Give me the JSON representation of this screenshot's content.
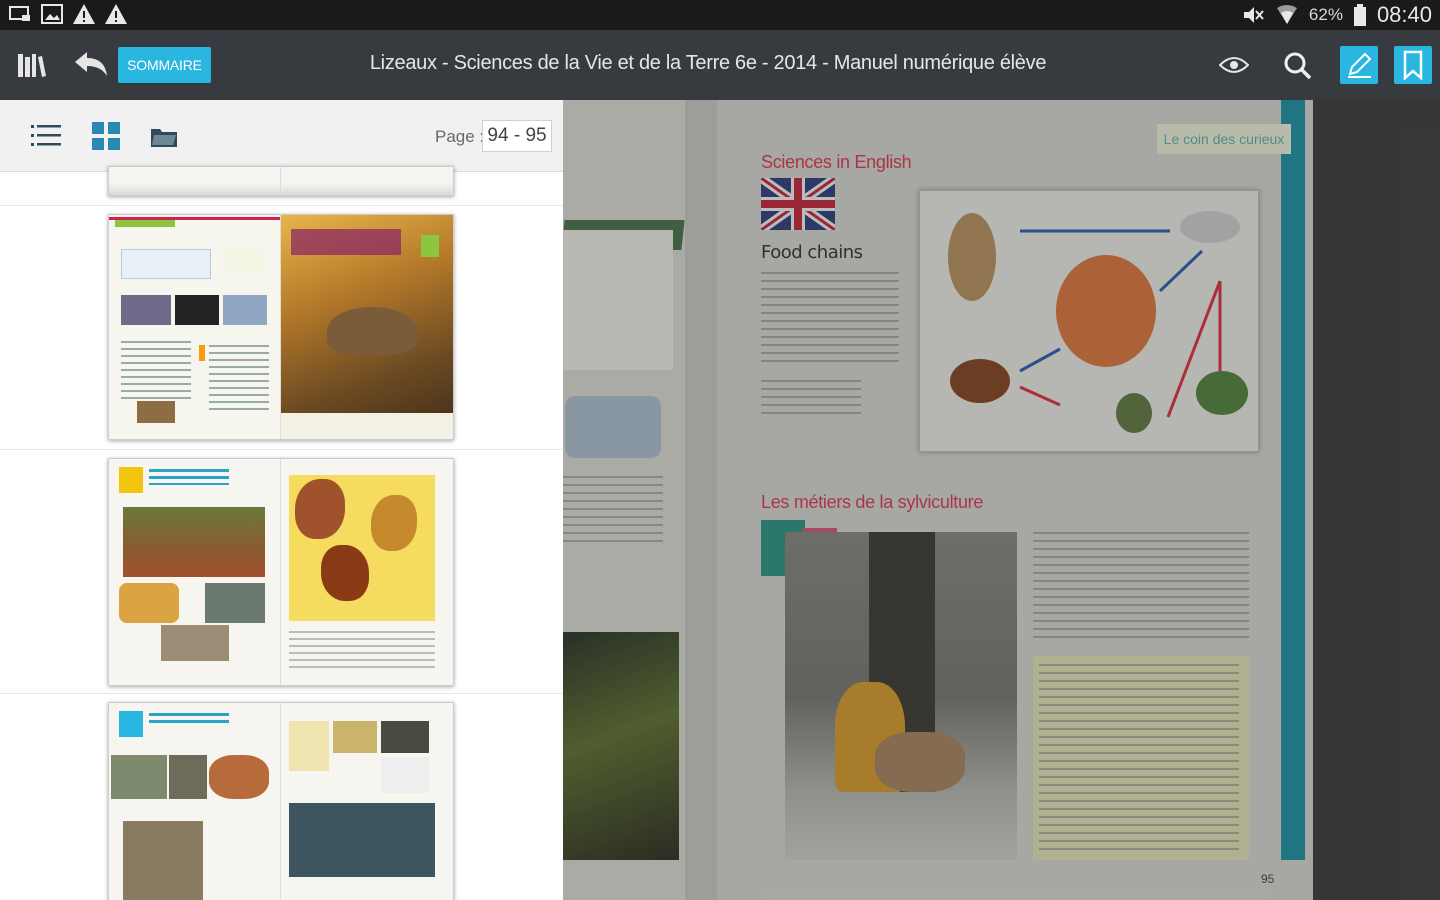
{
  "status_bar": {
    "icons_left": [
      "screen-cast-icon",
      "image-icon",
      "warning-icon",
      "warning-icon"
    ],
    "icons_right": [
      "mute-icon",
      "wifi-icon"
    ],
    "battery": "62%",
    "time": "08:40"
  },
  "app_bar": {
    "sommaire_label": "SOMMAIRE",
    "title": "Lizeaux - Sciences de la Vie et de la Terre 6e - 2014 - Manuel numérique élève",
    "accent": "#29b6e0"
  },
  "side_panel": {
    "page_label": "Page :",
    "page_value": "94 - 95"
  },
  "page_view": {
    "curieux_tab": "Le coin des curieux",
    "sciences_english": "Sciences in English",
    "food_chains": "Food chains",
    "metiers": "Les métiers de la sylviculture",
    "page_number": "95"
  }
}
